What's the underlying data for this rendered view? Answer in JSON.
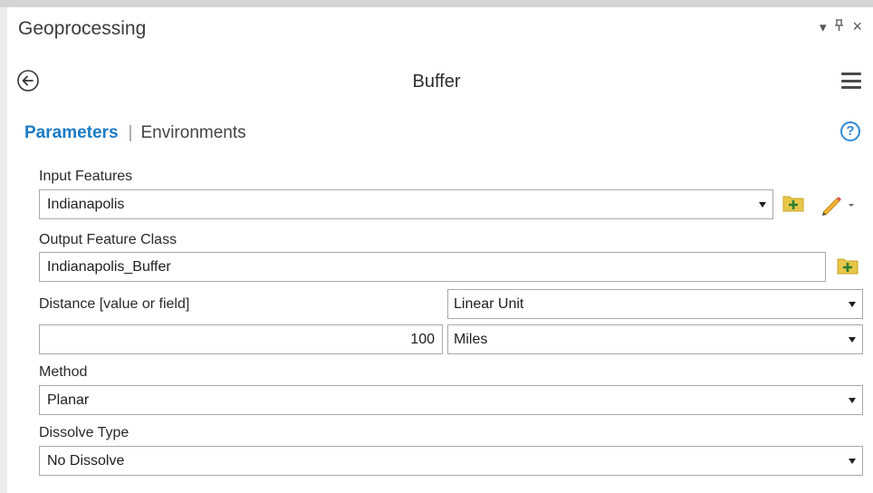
{
  "pane": {
    "title": "Geoprocessing",
    "controls": {
      "dropdown_glyph": "▾",
      "pin_glyph": "ⵖ",
      "close_glyph": "×"
    }
  },
  "tool": {
    "title": "Buffer"
  },
  "tabs": {
    "active": "Parameters",
    "separator": "|",
    "inactive": "Environments"
  },
  "help": {
    "glyph": "?"
  },
  "params": {
    "input_features": {
      "label": "Input Features",
      "value": "Indianapolis"
    },
    "output_feature_class": {
      "label": "Output Feature Class",
      "value": "Indianapolis_Buffer"
    },
    "distance": {
      "label": "Distance [value or field]",
      "type_value": "Linear Unit",
      "value": "100",
      "unit": "Miles"
    },
    "method": {
      "label": "Method",
      "value": "Planar"
    },
    "dissolve_type": {
      "label": "Dissolve Type",
      "value": "No Dissolve"
    }
  },
  "colors": {
    "accent": "#1a7bc6",
    "folder": "#e7c64a",
    "folder_plus": "#2e7d32"
  }
}
